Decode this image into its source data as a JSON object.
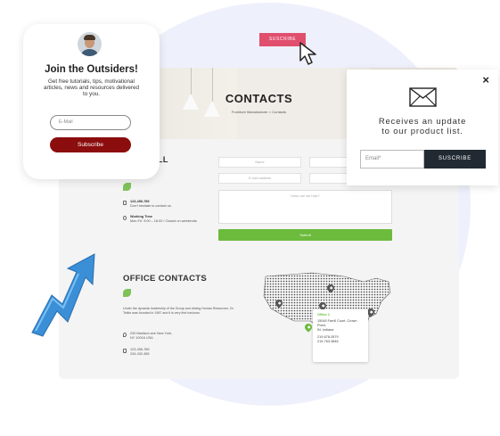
{
  "colors": {
    "brand_green": "#6cbb3c",
    "top_button": "#e14f6e",
    "left_button": "#8b0d0d",
    "right_button": "#212a33",
    "arrow": "#3a8fd6"
  },
  "top_subscribe": {
    "label": "SUSCRIBE"
  },
  "contacts_page": {
    "hero_title": "CONTACTS",
    "breadcrumb": "Furniture Manufacturer  >  Contacts",
    "form_section_title": "... OR FILL\n... ORM",
    "form": {
      "name_placeholder": "Name",
      "company_placeholder": "Co...",
      "email_placeholder": "E-mail address",
      "phone_placeholder": "Ph...",
      "message_placeholder": "Have can we help?",
      "submit_label": "Submit"
    },
    "phone_block": {
      "line1": "123-456-789",
      "line2": "Don't hesitate to contact us."
    },
    "hours_block": {
      "head": "Working Time",
      "line": "Mon-Fri: 9:00 – 18:00 / Closed on weekends"
    },
    "office_title": "OFFICE CONTACTS",
    "office_text": "Under the dynamic leadership of the Group and driving Human Resources. Dr. Teikle was founded in 1987 and it is very first horizons",
    "address_block": {
      "line1": "230 Madison ave New York,",
      "line2": "NY 10016 USA"
    },
    "phones_block": {
      "line1": "123-456-789",
      "line2": "234-432-456"
    },
    "office_card": {
      "title": "Office 1",
      "address1": "15045 Farrill Court, Crown",
      "address2": "Point,",
      "address3": "IN, Indiana",
      "phone1": "219-678-0579",
      "phone2": "219-763-3846"
    }
  },
  "left_popup": {
    "title": "Join the Outsiders!",
    "description": "Get free tutorials, tips, motivational articles, news and resources delivered to you.",
    "email_placeholder": "E-Mail",
    "button_label": "Subscribe"
  },
  "right_popup": {
    "close_symbol": "×",
    "message_line1": "Receives an update",
    "message_line2": "to our product list.",
    "email_placeholder": "Email*",
    "button_label": "SUSCRIBE"
  }
}
